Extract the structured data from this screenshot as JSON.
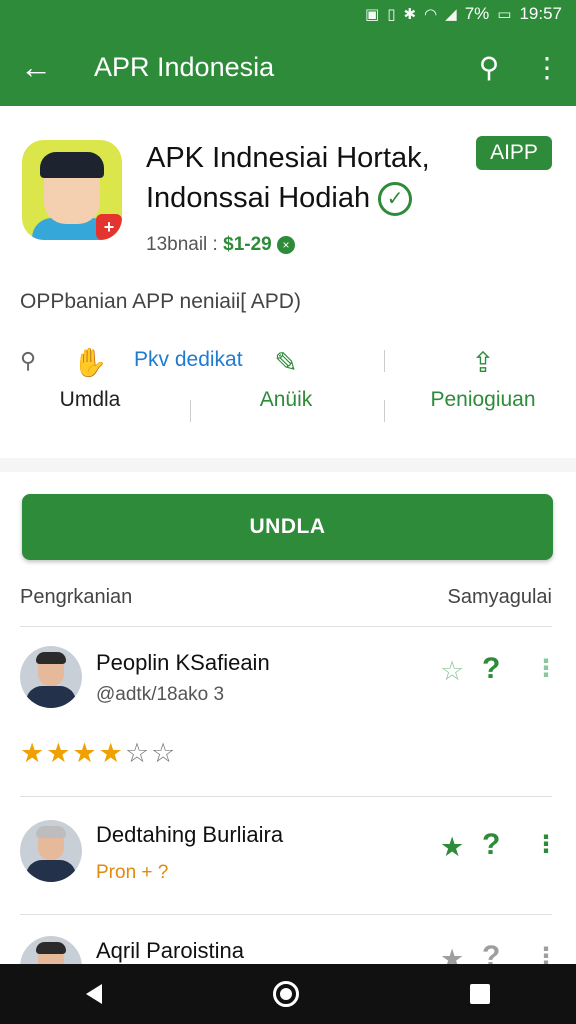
{
  "status_bar": {
    "time": "19:57",
    "battery": "7%",
    "icons": [
      "nfc-icon",
      "vibrate-icon",
      "bluetooth-icon",
      "wifi-icon",
      "signal-icon",
      "battery-icon"
    ]
  },
  "app_bar": {
    "title": "APR Indonesia",
    "back_icon": "arrow-left-icon",
    "search_icon": "search-icon",
    "more_icon": "more-vert-icon"
  },
  "app": {
    "name_line1": "APK Indnesiai Hortak,",
    "name_line2": "Indonssai Hodiah",
    "chip": "AIPP",
    "meta_prefix": "13bnail :",
    "price": "$1-29",
    "description": "OPPbanian APP neniaii[ APD)"
  },
  "actions": {
    "link_text": "Pkv dedikat",
    "col1_label": "Umdla",
    "col2_label": "Anüik",
    "col3_label": "Peniogiuan"
  },
  "install_button": "UNDLA",
  "reviews": {
    "heading_left": "Pengrkanian",
    "heading_right": "Samyagulai",
    "items": [
      {
        "name": "Peoplin KSafieain",
        "sub": "@adtk/18ako 3",
        "rating_text": "★★★★☆"
      },
      {
        "name": "Dedtahing Burliaira",
        "sub": "Pron + ?"
      },
      {
        "name": "Aqril Paroistina"
      }
    ]
  },
  "colors": {
    "primary": "#2e8b3a",
    "star": "#f0a000",
    "link": "#1f7bd0"
  }
}
